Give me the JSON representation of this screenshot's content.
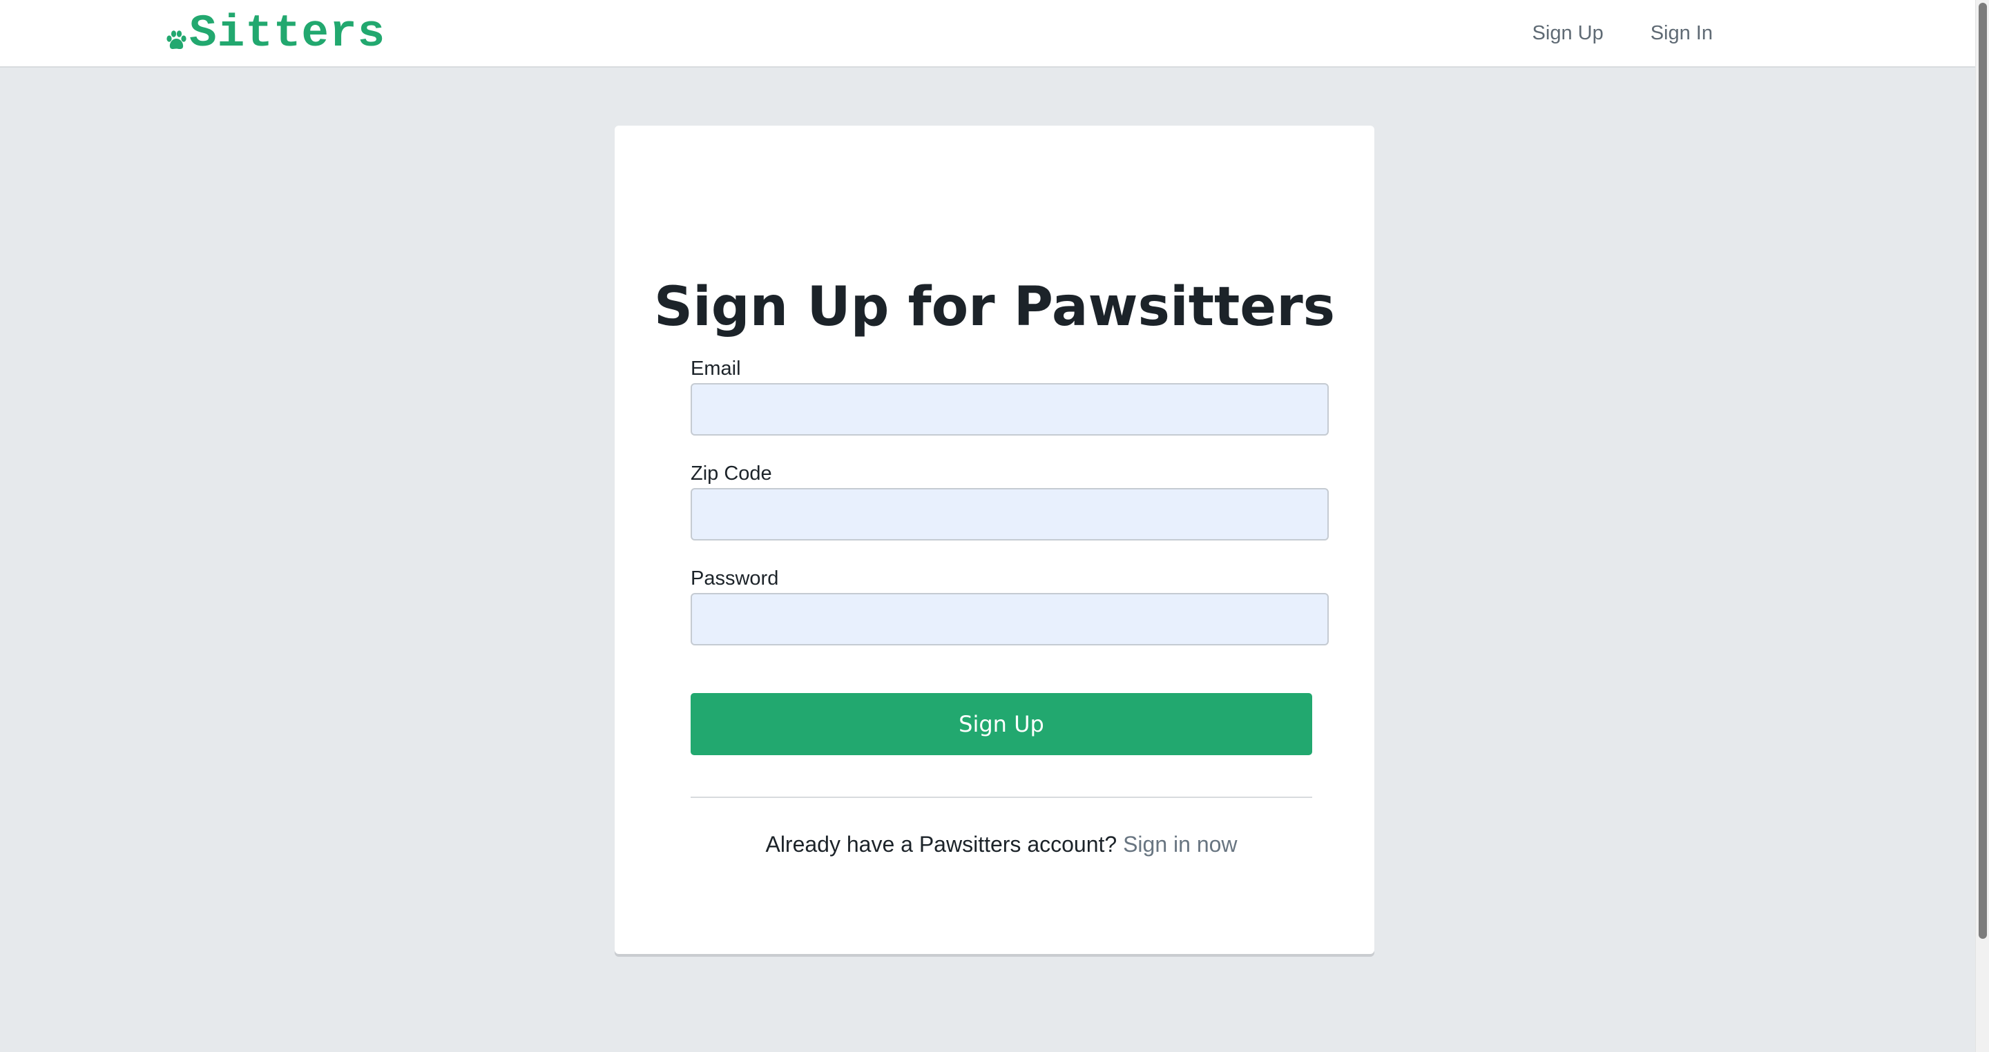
{
  "brand": {
    "text": "Sitters",
    "icon": "paw-icon",
    "color": "#22a86f"
  },
  "nav": {
    "items": [
      {
        "label": "Sign Up"
      },
      {
        "label": "Sign In"
      }
    ]
  },
  "signup": {
    "title": "Sign Up for Pawsitters",
    "fields": [
      {
        "label": "Email",
        "value": ""
      },
      {
        "label": "Zip Code",
        "value": ""
      },
      {
        "label": "Password",
        "value": ""
      }
    ],
    "submit_label": "Sign Up",
    "footer_text": "Already have a Pawsitters account?",
    "footer_link": "Sign in now"
  },
  "colors": {
    "accent": "#22a86f",
    "background": "#e6e9ec",
    "input_fill": "#e8f0fd",
    "text": "#1c2329",
    "muted_link": "#687581"
  }
}
